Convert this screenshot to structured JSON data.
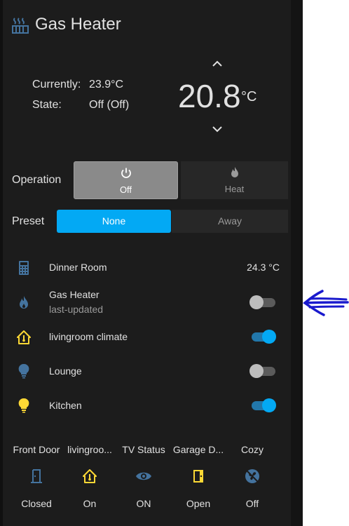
{
  "card": {
    "title": "Gas Heater",
    "header_icon": "radiator-icon",
    "current_label": "Currently:",
    "current_value": "23.9°C",
    "state_label": "State:",
    "state_value": "Off (Off)",
    "target_value": "20.8",
    "target_unit": "°C"
  },
  "operation": {
    "label": "Operation",
    "modes": [
      {
        "label": "Off",
        "icon": "power-icon",
        "selected": true
      },
      {
        "label": "Heat",
        "icon": "fire-icon",
        "selected": false
      }
    ]
  },
  "preset": {
    "label": "Preset",
    "options": [
      {
        "label": "None",
        "selected": true
      },
      {
        "label": "Away",
        "selected": false
      }
    ]
  },
  "entities": [
    {
      "name": "Dinner Room",
      "state": "24.3 °C",
      "icon": "calculator-icon",
      "icon_color": "#44739e"
    },
    {
      "name": "Gas Heater",
      "secondary": "last-updated",
      "toggle": "off",
      "icon": "fire-icon",
      "icon_color": "#44739e"
    },
    {
      "name": "livingroom climate",
      "toggle": "on",
      "icon": "home-thermometer-icon",
      "icon_color": "#fdd835"
    },
    {
      "name": "Lounge",
      "toggle": "off",
      "icon": "lightbulb-icon",
      "icon_color": "#44739e"
    },
    {
      "name": "Kitchen",
      "toggle": "on",
      "icon": "lightbulb-icon",
      "icon_color": "#fdd835"
    }
  ],
  "glance": [
    {
      "name": "Front Door",
      "state": "Closed",
      "icon": "door-closed-icon",
      "icon_color": "#44739e"
    },
    {
      "name": "livingroo...",
      "state": "On",
      "icon": "home-thermometer-icon",
      "icon_color": "#fdd835"
    },
    {
      "name": "TV Status",
      "state": "ON",
      "icon": "eye-icon",
      "icon_color": "#44739e"
    },
    {
      "name": "Garage D...",
      "state": "Open",
      "icon": "door-open-icon",
      "icon_color": "#fdd835"
    },
    {
      "name": "Cozy",
      "state": "Off",
      "icon": "fan-off-icon",
      "icon_color": "#44739e"
    }
  ],
  "colors": {
    "card_bg": "#1c1c1c",
    "accent": "#03a9f4",
    "icon_blue": "#44739e",
    "icon_yellow": "#fdd835",
    "annotation": "#1a1acd"
  }
}
